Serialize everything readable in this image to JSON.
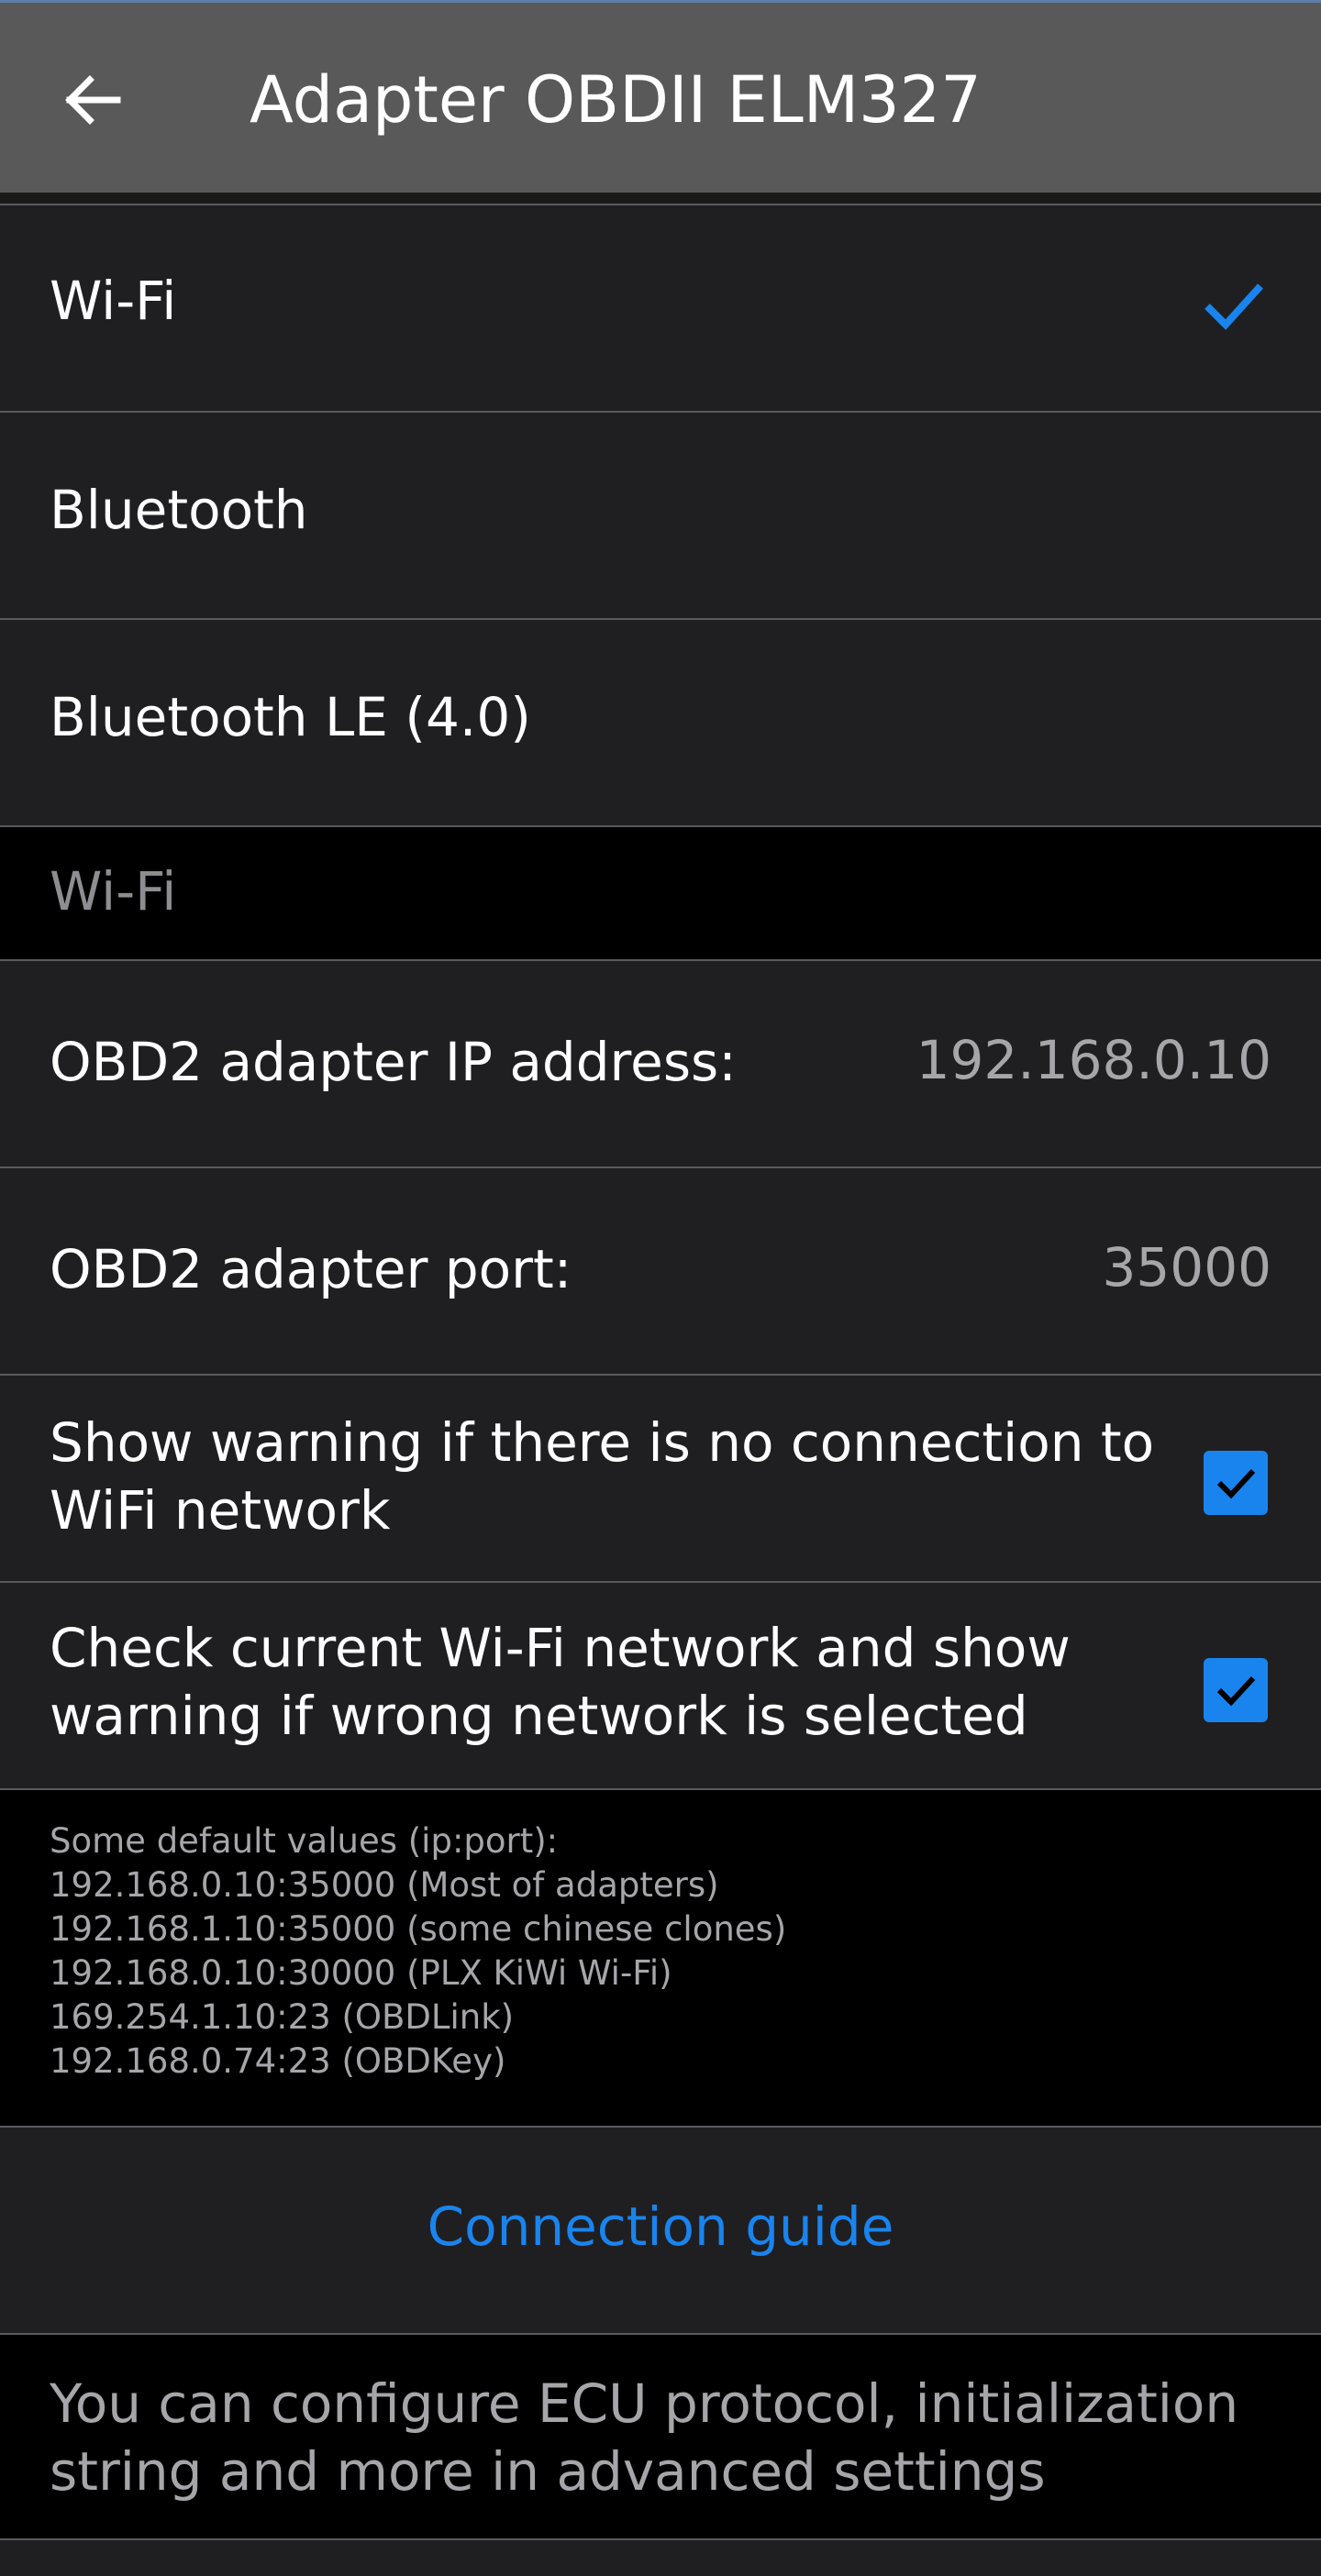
{
  "header": {
    "title": "Adapter OBDII ELM327",
    "back_icon": "arrow-left-icon"
  },
  "connection_types": [
    {
      "label": "Wi-Fi",
      "selected": true
    },
    {
      "label": "Bluetooth",
      "selected": false
    },
    {
      "label": "Bluetooth LE (4.0)",
      "selected": false
    }
  ],
  "wifi_section": {
    "header": "Wi-Fi",
    "ip_label": "OBD2 adapter IP address:",
    "ip_value": "192.168.0.10",
    "port_label": "OBD2 adapter port:",
    "port_value": "35000",
    "warn_no_connection": {
      "label": "Show warning if there is no connection to WiFi network",
      "checked": true
    },
    "warn_wrong_network": {
      "label": "Check current Wi-Fi network and show warning if wrong network is selected",
      "checked": true
    }
  },
  "defaults_info": {
    "lines": [
      "Some default values (ip:port):",
      "192.168.0.10:35000 (Most of adapters)",
      "192.168.1.10:35000 (some chinese clones)",
      "192.168.0.10:30000 (PLX KiWi Wi-Fi)",
      "169.254.1.10:23 (OBDLink)",
      "192.168.0.74:23 (OBDKey)"
    ]
  },
  "connection_guide": "Connection guide",
  "advanced_note": "You can configure ECU protocol, initialization string and more in advanced settings",
  "colors": {
    "accent": "#1a84ee",
    "appbar": "#595959",
    "row_bg": "#1f1f21",
    "section_bg": "#000000"
  }
}
